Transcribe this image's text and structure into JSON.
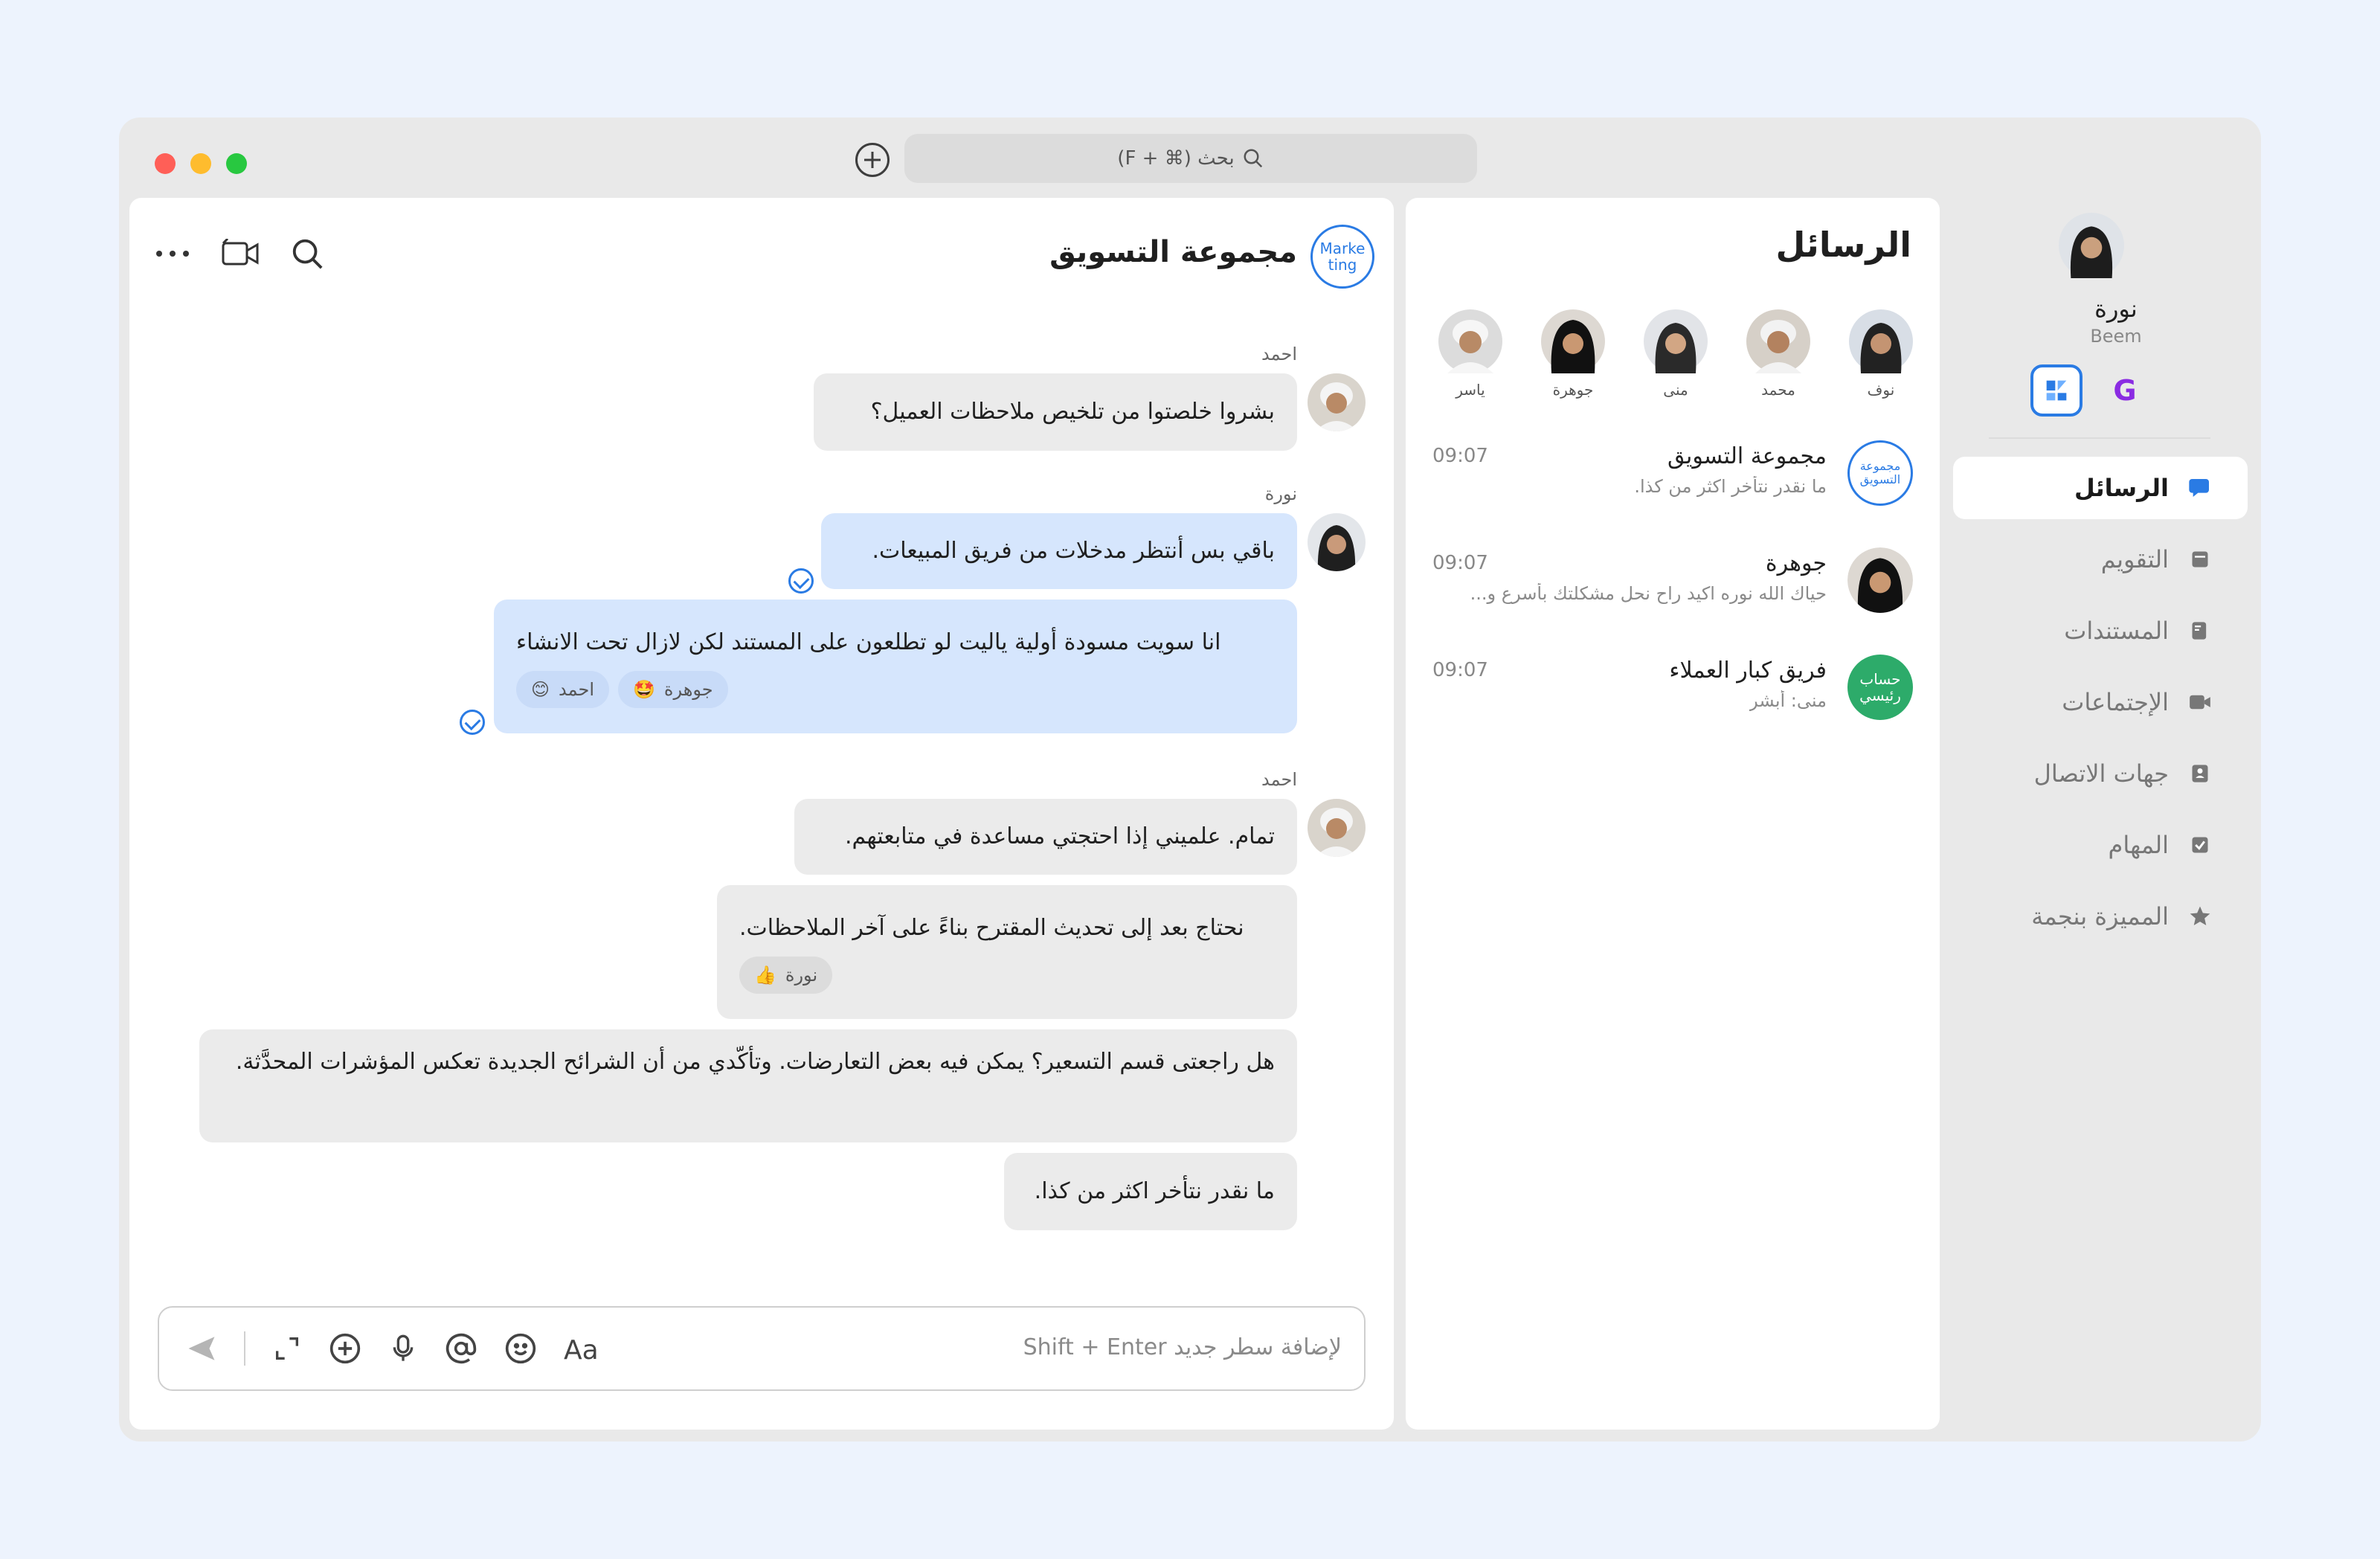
{
  "titlebar": {
    "search_placeholder": "بحث (⌘ + F)"
  },
  "sidebar": {
    "user_name": "نورة",
    "user_org": "Beem",
    "app_g_label": "G",
    "items": [
      {
        "label": "الرسائل",
        "icon": "messages-icon",
        "active": true
      },
      {
        "label": "التقويم",
        "icon": "calendar-icon",
        "active": false
      },
      {
        "label": "المستندات",
        "icon": "documents-icon",
        "active": false
      },
      {
        "label": "الإجتماعات",
        "icon": "meetings-icon",
        "active": false
      },
      {
        "label": "جهات الاتصال",
        "icon": "contacts-icon",
        "active": false
      },
      {
        "label": "المهام",
        "icon": "tasks-icon",
        "active": false
      },
      {
        "label": "المميزة بنجمة",
        "icon": "star-icon",
        "active": false
      }
    ]
  },
  "list": {
    "title": "الرسائل",
    "stories": [
      "نوف",
      "محمد",
      "منى",
      "جوهرة",
      "ياسر"
    ],
    "conversations": [
      {
        "title": "مجموعة التسويق",
        "preview": "ما نقدر نتأخر اكثر من كذا.",
        "time": "09:07",
        "badge": "مجموعة التسويق"
      },
      {
        "title": "جوهرة",
        "preview": "حياك الله نوره اكيد راح نحل مشكلتك بأسرع و...",
        "time": "09:07"
      },
      {
        "title": "فريق كبار العملاء",
        "preview": "منى: أبشر",
        "time": "09:07",
        "badge": "حساب رئيسي",
        "badge_color": "#2dab6a"
      }
    ]
  },
  "chat": {
    "title": "مجموعة التسويق",
    "badge": "Marke ting",
    "messages": [
      {
        "sender": "احمد",
        "text": "بشروا خلصتوا من تلخيص ملاحظات العميل؟"
      },
      {
        "sender": "نورة",
        "text": "باقي بس أنتظر مدخلات من فريق المبيعات."
      },
      {
        "text": "انا  سويت مسودة أولية ياليت لو تطلعون على المستند لكن لازال تحت الانشاء",
        "reactions": [
          {
            "name": "احمد",
            "emoji": "😊"
          },
          {
            "name": "جوهرة",
            "emoji": "🤩"
          }
        ]
      },
      {
        "sender": "احمد",
        "text": "تمام. علميني إذا احتجتي مساعدة في متابعتهم."
      },
      {
        "text": "نحتاج بعد إلى تحديث المقترح بناءً على آخر الملاحظات.",
        "reactions": [
          {
            "name": "نورة",
            "emoji": "👍"
          }
        ]
      },
      {
        "text": "هل راجعتى قسم التسعير؟ يمكن فيه بعض التعارضات. وتأكّدي من أن الشرائح الجديدة تعكس المؤشرات المحدَّثة."
      },
      {
        "text": "ما نقدر نتأخر اكثر من كذا."
      }
    ],
    "composer_placeholder": "Shift + Enter  لإضافة سطر جديد"
  },
  "colors": {
    "accent": "#2a7be4",
    "bubble_blue": "#d6e6fd",
    "bubble_gray": "#ebebeb",
    "green_badge": "#2dab6a"
  }
}
